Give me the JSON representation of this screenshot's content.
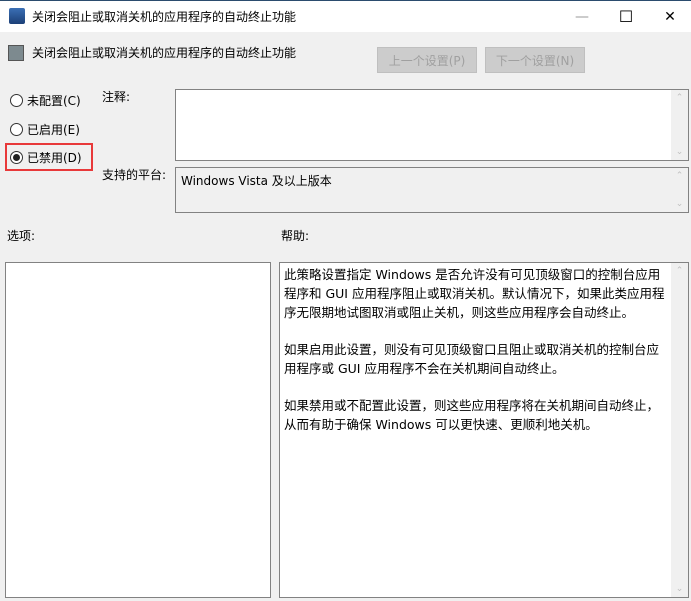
{
  "window": {
    "title": "关闭会阻止或取消关机的应用程序的自动终止功能",
    "minimize": "—",
    "maximize": "☐",
    "close": "✕"
  },
  "header": {
    "title": "关闭会阻止或取消关机的应用程序的自动终止功能",
    "prev_label": "上一个设置(P)",
    "next_label": "下一个设置(N)"
  },
  "radios": [
    {
      "label": "未配置(C)",
      "checked": false
    },
    {
      "label": "已启用(E)",
      "checked": false
    },
    {
      "label": "已禁用(D)",
      "checked": true
    }
  ],
  "comment": {
    "label": "注释:",
    "value": ""
  },
  "platform": {
    "label": "支持的平台:",
    "value": "Windows Vista 及以上版本"
  },
  "options": {
    "label": "选项:"
  },
  "help": {
    "label": "帮助:",
    "paragraphs": [
      "此策略设置指定 Windows 是否允许没有可见顶级窗口的控制台应用程序和 GUI 应用程序阻止或取消关机。默认情况下，如果此类应用程序无限期地试图取消或阻止关机，则这些应用程序会自动终止。",
      "如果启用此设置，则没有可见顶级窗口且阻止或取消关机的控制台应用程序或 GUI 应用程序不会在关机期间自动终止。",
      "如果禁用或不配置此设置，则这些应用程序将在关机期间自动终止，从而有助于确保 Windows 可以更快速、更顺利地关机。"
    ]
  },
  "colors": {
    "highlight": "#e8393a",
    "disabled_button": "#cccccc"
  }
}
